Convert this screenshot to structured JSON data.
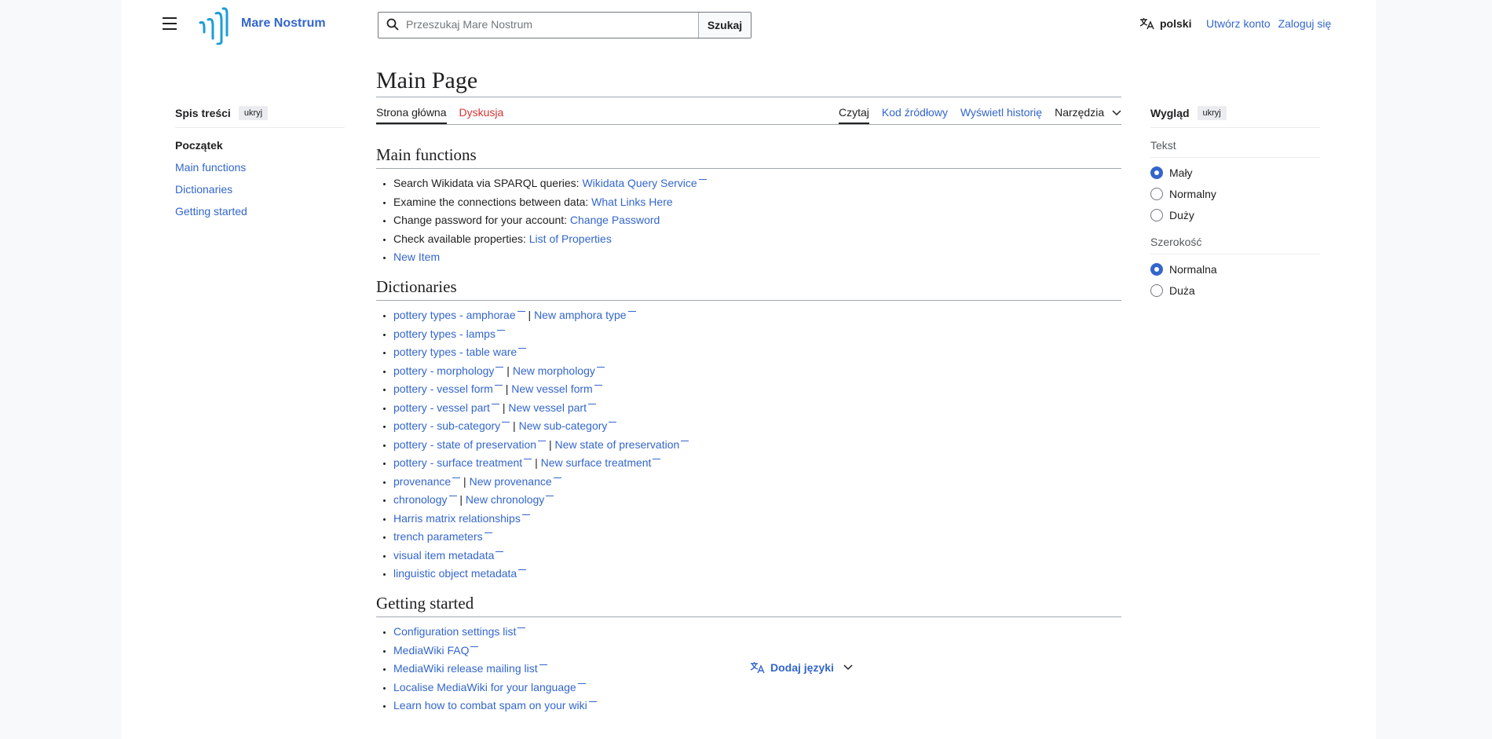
{
  "header": {
    "site_name": "Mare Nostrum",
    "search_placeholder": "Przeszukaj Mare Nostrum",
    "search_button": "Szukaj",
    "language": "polski",
    "create_account": "Utwórz konto",
    "log_in": "Zaloguj się"
  },
  "toc": {
    "title": "Spis treści",
    "hide": "ukryj",
    "items": [
      "Początek",
      "Main functions",
      "Dictionaries",
      "Getting started"
    ]
  },
  "page": {
    "title": "Main Page",
    "tabs_left": [
      "Strona główna",
      "Dyskusja"
    ],
    "tabs_right": [
      "Czytaj",
      "Kod źródłowy",
      "Wyświetl historię",
      "Narzędzia"
    ]
  },
  "main_functions": {
    "heading": "Main functions",
    "items": [
      {
        "text": "Search Wikidata via SPARQL queries: ",
        "link": "Wikidata Query Service"
      },
      {
        "text": "Examine the connections between data: ",
        "link": "What Links Here"
      },
      {
        "text": "Change password for your account: ",
        "link": "Change Password"
      },
      {
        "text": "Check available properties: ",
        "link": "List of Properties"
      },
      {
        "text": "",
        "link": "New Item"
      }
    ]
  },
  "dictionaries": {
    "heading": "Dictionaries",
    "items": [
      {
        "a": "pottery types - amphorae",
        "b": "New amphora type"
      },
      {
        "a": "pottery types - lamps",
        "b": ""
      },
      {
        "a": "pottery types - table ware",
        "b": ""
      },
      {
        "a": "pottery - morphology",
        "b": "New morphology"
      },
      {
        "a": "pottery - vessel form",
        "b": "New vessel form"
      },
      {
        "a": "pottery - vessel part",
        "b": "New vessel part"
      },
      {
        "a": "pottery - sub-category",
        "b": "New sub-category"
      },
      {
        "a": "pottery - state of preservation",
        "b": "New state of preservation"
      },
      {
        "a": "pottery - surface treatment",
        "b": "New surface treatment"
      },
      {
        "a": "provenance",
        "b": "New provenance"
      },
      {
        "a": "chronology",
        "b": "New chronology"
      },
      {
        "a": "Harris matrix relationships",
        "b": ""
      },
      {
        "a": "trench parameters",
        "b": ""
      },
      {
        "a": "visual item metadata",
        "b": ""
      },
      {
        "a": "linguistic object metadata",
        "b": ""
      }
    ]
  },
  "getting_started": {
    "heading": "Getting started",
    "items": [
      "Configuration settings list",
      "MediaWiki FAQ",
      "MediaWiki release mailing list",
      "Localise MediaWiki for your language",
      "Learn how to combat spam on your wiki"
    ]
  },
  "add_languages": "Dodaj języki",
  "appearance": {
    "title": "Wygląd",
    "hide": "ukryj",
    "text_label": "Tekst",
    "text_options": [
      {
        "label": "Mały",
        "selected": true
      },
      {
        "label": "Normalny",
        "selected": false
      },
      {
        "label": "Duży",
        "selected": false
      }
    ],
    "width_label": "Szerokość",
    "width_options": [
      {
        "label": "Normalna",
        "selected": true
      },
      {
        "label": "Duża",
        "selected": false
      }
    ]
  },
  "colors": {
    "link": "#3366cc",
    "discussion_tab": "#d73333",
    "logo": "#1b9dd9"
  }
}
